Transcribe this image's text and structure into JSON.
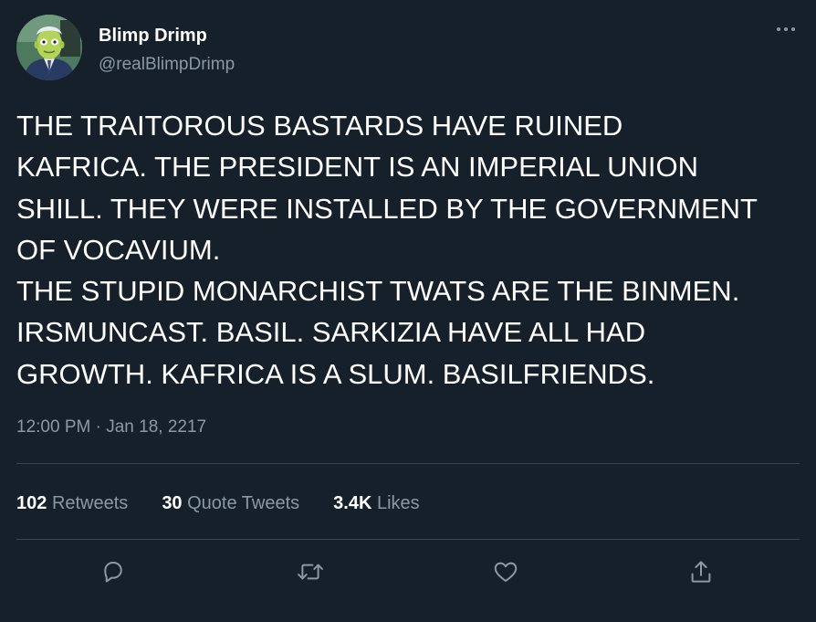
{
  "author": {
    "display_name": "Blimp Drimp",
    "handle": "@realBlimpDrimp",
    "avatar_icon": "avatar-cartoon-man-icon"
  },
  "tweet": {
    "lines": [
      "THE TRAITOROUS BASTARDS HAVE RUINED",
      "KAFRICA. THE PRESIDENT IS AN IMPERIAL UNION",
      "SHILL. THEY WERE INSTALLED BY THE GOVERNMENT",
      "OF VOCAVIUM.",
      "THE STUPID MONARCHIST TWATS ARE THE BINMEN.",
      "IRSMUNCAST. BASIL. SARKIZIA HAVE ALL HAD",
      "GROWTH. KAFRICA IS A SLUM. BASILFRIENDS."
    ],
    "timestamp": "12:00 PM · Jan 18, 2217"
  },
  "stats": {
    "retweets": {
      "count": "102",
      "label": "Retweets"
    },
    "quote_tweets": {
      "count": "30",
      "label": "Quote Tweets"
    },
    "likes": {
      "count": "3.4K",
      "label": "Likes"
    }
  },
  "actions": [
    "reply-icon",
    "retweet-icon",
    "like-icon",
    "share-icon"
  ],
  "colors": {
    "background": "#15202b",
    "text": "#ffffff",
    "secondary_text": "#8b98a5",
    "divider": "#38444d"
  }
}
